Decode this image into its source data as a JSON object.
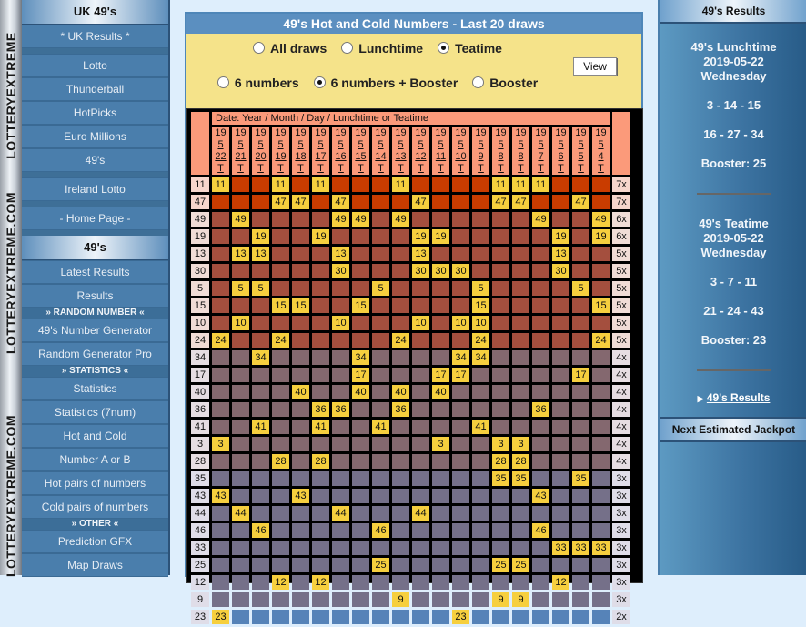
{
  "brand_vertical": [
    "LOTTERYEXTREME",
    "LOTTERYEXTREME.COM",
    "LOTTERYEXTREME.COM"
  ],
  "left_nav": {
    "header1": "UK 49's",
    "items1": [
      "* UK Results *"
    ],
    "items2": [
      "Lotto",
      "Thunderball",
      "HotPicks",
      "Euro Millions",
      "49's"
    ],
    "items3": [
      "Ireland Lotto"
    ],
    "items4": [
      "- Home Page -"
    ],
    "header2": "49's",
    "items5": [
      "Latest Results",
      "Results"
    ],
    "section_random": "» RANDOM NUMBER «",
    "items6": [
      "49's Number Generator",
      "Random Generator Pro"
    ],
    "section_statistics": "» STATISTICS «",
    "items7": [
      "Statistics",
      "Statistics (7num)",
      "Hot and Cold",
      "Number A or B",
      "Hot pairs of numbers",
      "Cold pairs of numbers"
    ],
    "section_other": "» OTHER «",
    "items8": [
      "Prediction GFX",
      "Map Draws"
    ]
  },
  "main": {
    "title": "49's Hot and Cold Numbers - Last 20 draws",
    "draw_options": [
      {
        "label": "All draws",
        "selected": false
      },
      {
        "label": "Lunchtime",
        "selected": false
      },
      {
        "label": "Teatime",
        "selected": true
      }
    ],
    "number_options": [
      {
        "label": "6 numbers",
        "selected": false
      },
      {
        "label": "6 numbers + Booster",
        "selected": true
      },
      {
        "label": "Booster",
        "selected": false
      }
    ],
    "view_button": "View",
    "date_header": "Date: Year / Month / Day / Lunchtime or Teatime",
    "draws": [
      {
        "y": "19",
        "m": "5",
        "d": "22",
        "t": "T"
      },
      {
        "y": "19",
        "m": "5",
        "d": "21",
        "t": "T"
      },
      {
        "y": "19",
        "m": "5",
        "d": "20",
        "t": "T"
      },
      {
        "y": "19",
        "m": "5",
        "d": "19",
        "t": "T"
      },
      {
        "y": "19",
        "m": "5",
        "d": "18",
        "t": "T"
      },
      {
        "y": "19",
        "m": "5",
        "d": "17",
        "t": "T"
      },
      {
        "y": "19",
        "m": "5",
        "d": "16",
        "t": "T"
      },
      {
        "y": "19",
        "m": "5",
        "d": "15",
        "t": "T"
      },
      {
        "y": "19",
        "m": "5",
        "d": "14",
        "t": "T"
      },
      {
        "y": "19",
        "m": "5",
        "d": "13",
        "t": "T"
      },
      {
        "y": "19",
        "m": "5",
        "d": "12",
        "t": "T"
      },
      {
        "y": "19",
        "m": "5",
        "d": "11",
        "t": "T"
      },
      {
        "y": "19",
        "m": "5",
        "d": "10",
        "t": "T"
      },
      {
        "y": "19",
        "m": "5",
        "d": "9",
        "t": "T"
      },
      {
        "y": "19",
        "m": "5",
        "d": "8",
        "t": "T"
      },
      {
        "y": "19",
        "m": "5",
        "d": "8",
        "t": "T"
      },
      {
        "y": "19",
        "m": "5",
        "d": "7",
        "t": "T"
      },
      {
        "y": "19",
        "m": "5",
        "d": "6",
        "t": "T"
      },
      {
        "y": "19",
        "m": "5",
        "d": "5",
        "t": "T"
      },
      {
        "y": "19",
        "m": "5",
        "d": "4",
        "t": "T"
      }
    ],
    "row_colors": {
      "7x": "#c93c00",
      "6x": "#a44f3e",
      "5x": "#a44f3e",
      "4x": "#84686f",
      "3x": "#757089",
      "2x": "#5683b8"
    },
    "label_colors": {
      "7x": "#f6d6cc",
      "6x": "#f0dcd6",
      "5x": "#f0dcd6",
      "4x": "#e6dde2",
      "3x": "#dfdde8",
      "2x": "#dfdde8"
    },
    "rows": [
      {
        "num": "11",
        "count": "7x",
        "hits": [
          1,
          4,
          6,
          10,
          15,
          16,
          17
        ]
      },
      {
        "num": "47",
        "count": "7x",
        "hits": [
          4,
          5,
          7,
          11,
          15,
          16,
          19
        ]
      },
      {
        "num": "49",
        "count": "6x",
        "hits": [
          2,
          7,
          8,
          10,
          17,
          20
        ]
      },
      {
        "num": "19",
        "count": "6x",
        "hits": [
          3,
          6,
          11,
          12,
          18,
          20
        ]
      },
      {
        "num": "13",
        "count": "5x",
        "hits": [
          2,
          3,
          7,
          11,
          18
        ]
      },
      {
        "num": "30",
        "count": "5x",
        "hits": [
          7,
          11,
          12,
          13,
          18
        ]
      },
      {
        "num": "5",
        "count": "5x",
        "hits": [
          2,
          3,
          9,
          14,
          19
        ]
      },
      {
        "num": "15",
        "count": "5x",
        "hits": [
          4,
          5,
          8,
          14,
          20
        ]
      },
      {
        "num": "10",
        "count": "5x",
        "hits": [
          2,
          7,
          11,
          13,
          14
        ]
      },
      {
        "num": "24",
        "count": "5x",
        "hits": [
          1,
          4,
          10,
          14,
          20
        ]
      },
      {
        "num": "34",
        "count": "4x",
        "hits": [
          3,
          8,
          13,
          14
        ]
      },
      {
        "num": "17",
        "count": "4x",
        "hits": [
          8,
          12,
          13,
          19
        ]
      },
      {
        "num": "40",
        "count": "4x",
        "hits": [
          5,
          8,
          10,
          12
        ]
      },
      {
        "num": "36",
        "count": "4x",
        "hits": [
          6,
          7,
          10,
          17
        ]
      },
      {
        "num": "41",
        "count": "4x",
        "hits": [
          3,
          6,
          9,
          14
        ]
      },
      {
        "num": "3",
        "count": "4x",
        "hits": [
          1,
          12,
          15,
          16
        ]
      },
      {
        "num": "28",
        "count": "4x",
        "hits": [
          4,
          6,
          15,
          16
        ]
      },
      {
        "num": "35",
        "count": "3x",
        "hits": [
          15,
          16,
          19
        ]
      },
      {
        "num": "43",
        "count": "3x",
        "hits": [
          1,
          5,
          17
        ]
      },
      {
        "num": "44",
        "count": "3x",
        "hits": [
          2,
          7,
          11
        ]
      },
      {
        "num": "46",
        "count": "3x",
        "hits": [
          3,
          9,
          17
        ]
      },
      {
        "num": "33",
        "count": "3x",
        "hits": [
          18,
          19,
          20
        ]
      },
      {
        "num": "25",
        "count": "3x",
        "hits": [
          9,
          15,
          16
        ]
      },
      {
        "num": "12",
        "count": "3x",
        "hits": [
          4,
          6,
          18
        ]
      },
      {
        "num": "9",
        "count": "3x",
        "hits": [
          10,
          15,
          16
        ]
      },
      {
        "num": "23",
        "count": "2x",
        "hits": [
          1,
          13
        ]
      }
    ]
  },
  "right_sidebar": {
    "header": "49's Results",
    "lunchtime": {
      "title": "49's Lunchtime",
      "date": "2019-05-22",
      "day": "Wednesday",
      "line1": "3 - 14 - 15",
      "line2": "16 - 27 - 34",
      "booster": "Booster: 25"
    },
    "teatime": {
      "title": "49's Teatime",
      "date": "2019-05-22",
      "day": "Wednesday",
      "line1": "3 - 7 - 11",
      "line2": "21 - 24 - 43",
      "booster": "Booster: 23"
    },
    "results_link": "49's Results",
    "jackpot_header": "Next Estimated Jackpot"
  }
}
